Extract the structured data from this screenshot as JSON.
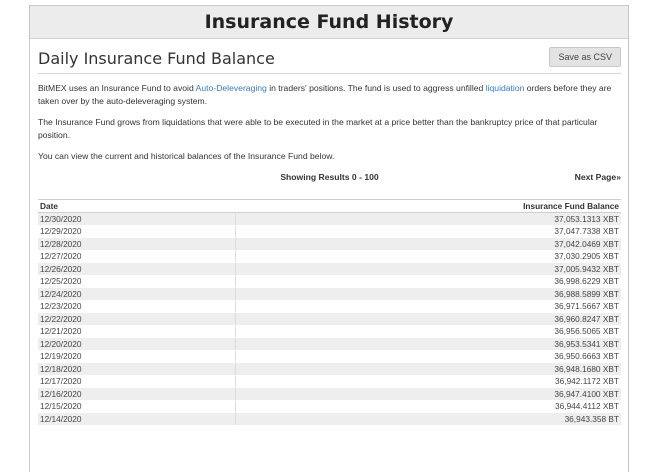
{
  "page": {
    "title": "Insurance Fund History",
    "subtitle": "Daily Insurance Fund Balance",
    "save_csv_label": "Save as CSV",
    "para1": {
      "t1": "BitMEX uses an Insurance Fund to avoid ",
      "link1": "Auto-Deleveraging",
      "t2": " in traders' positions. The fund is used to aggress unfilled ",
      "link2": "liquidation",
      "t3": " orders before they are taken over by the auto-deleveraging system."
    },
    "para2": "The Insurance Fund grows from liquidations that were able to be executed in the market at a price better than the bankruptcy price of that particular position.",
    "para3": "You can view the current and historical balances of the Insurance Fund below.",
    "results_text": "Showing Results 0 - 100",
    "next_page_label": "Next Page»"
  },
  "table": {
    "headers": {
      "date": "Date",
      "balance": "Insurance Fund Balance"
    },
    "rows": [
      {
        "date": "12/30/2020",
        "balance": "37,053.1313 XBT"
      },
      {
        "date": "12/29/2020",
        "balance": "37,047.7338 XBT"
      },
      {
        "date": "12/28/2020",
        "balance": "37,042.0469 XBT"
      },
      {
        "date": "12/27/2020",
        "balance": "37,030.2905 XBT"
      },
      {
        "date": "12/26/2020",
        "balance": "37,005.9432 XBT"
      },
      {
        "date": "12/25/2020",
        "balance": "36,998.6229 XBT"
      },
      {
        "date": "12/24/2020",
        "balance": "36,988.5899 XBT"
      },
      {
        "date": "12/23/2020",
        "balance": "36,971.5667 XBT"
      },
      {
        "date": "12/22/2020",
        "balance": "36,960.8247 XBT"
      },
      {
        "date": "12/21/2020",
        "balance": "36,956.5065 XBT"
      },
      {
        "date": "12/20/2020",
        "balance": "36,953.5341 XBT"
      },
      {
        "date": "12/19/2020",
        "balance": "36,950.6663 XBT"
      },
      {
        "date": "12/18/2020",
        "balance": "36,948.1680 XBT"
      },
      {
        "date": "12/17/2020",
        "balance": "36,942.1172 XBT"
      },
      {
        "date": "12/16/2020",
        "balance": "36,947.4100 XBT"
      },
      {
        "date": "12/15/2020",
        "balance": "36,944.4112 XBT"
      },
      {
        "date": "12/14/2020",
        "balance": "36,943.358 BT"
      }
    ]
  }
}
